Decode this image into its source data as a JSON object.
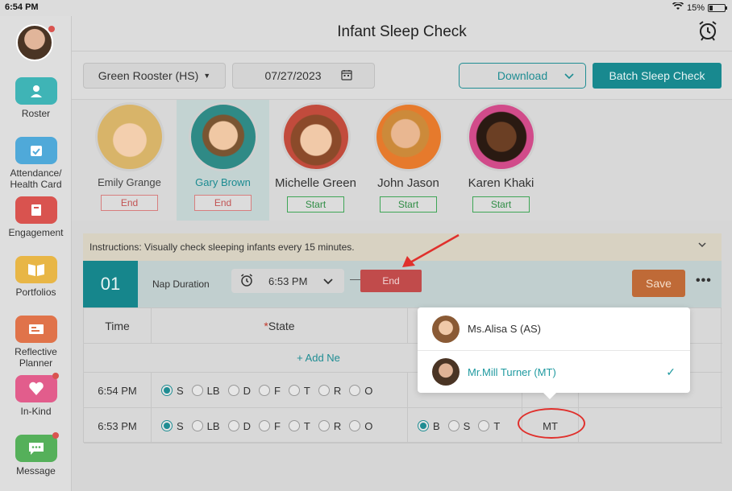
{
  "status_bar": {
    "time": "6:54 PM",
    "battery": "15%"
  },
  "sidebar": {
    "items": [
      {
        "label": "Roster",
        "icon": "person-icon",
        "color": "#3fb4b6"
      },
      {
        "label_line1": "Attendance/",
        "label_line2": "Health Card",
        "icon": "calendar-check-icon",
        "color": "#4fa9d9"
      },
      {
        "label": "Engagement",
        "icon": "note-icon",
        "color": "#d9534f"
      },
      {
        "label": "Portfolios",
        "icon": "book-icon",
        "color": "#e8b646"
      },
      {
        "label_line1": "Reflective",
        "label_line2": "Planner",
        "icon": "planner-icon",
        "color": "#e0734a"
      },
      {
        "label": "In-Kind",
        "icon": "heart-icon",
        "color": "#e25d8c"
      },
      {
        "label": "Message",
        "icon": "chat-icon",
        "color": "#55b05a"
      }
    ]
  },
  "header": {
    "title": "Infant Sleep Check"
  },
  "toolbar": {
    "classroom": "Green Rooster (HS)",
    "date": "07/27/2023",
    "download_label": "Download",
    "batch_label": "Batch Sleep Check"
  },
  "children": [
    {
      "name": "Emily Grange",
      "action": "End"
    },
    {
      "name": "Gary Brown",
      "action": "End"
    },
    {
      "name": "Michelle Green",
      "action": "Start"
    },
    {
      "name": "John Jason",
      "action": "Start"
    },
    {
      "name": "Karen Khaki",
      "action": "Start"
    }
  ],
  "instructions": "Instructions: Visually check sleeping infants every 15 minutes.",
  "nap": {
    "number": "01",
    "duration_label": "Nap Duration",
    "start_time": "6:53 PM",
    "separator": "—",
    "end_label": "End",
    "save_label": "Save",
    "more": "•••"
  },
  "table": {
    "col_time": "Time",
    "required_mark": "*",
    "col_state": "State",
    "add_label": "+ Add Ne",
    "state_options": [
      "S",
      "LB",
      "D",
      "F",
      "T",
      "R",
      "O"
    ],
    "position_options": [
      "B",
      "S",
      "T"
    ],
    "rows": [
      {
        "time": "6:54 PM",
        "state": "S",
        "position": "",
        "checker": ""
      },
      {
        "time": "6:53 PM",
        "state": "S",
        "position": "B",
        "checker": "MT"
      }
    ]
  },
  "popup": {
    "items": [
      {
        "label": "Ms.Alisa S (AS)",
        "selected": false
      },
      {
        "label": "Mr.Mill Turner (MT)",
        "selected": true
      }
    ],
    "check": "✓"
  },
  "colors": {
    "teal": "#16868c",
    "end_red": "#c14b4b",
    "save_orange": "#bf6a37",
    "annotation_red": "#e0302c"
  }
}
